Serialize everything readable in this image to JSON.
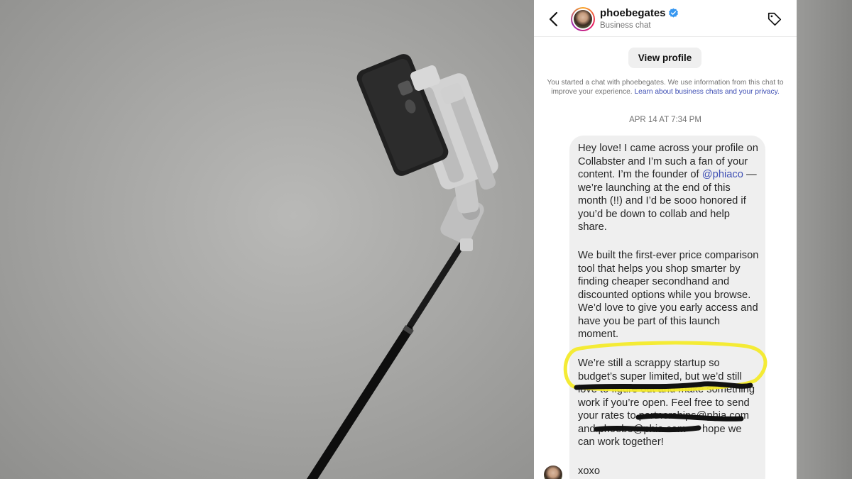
{
  "header": {
    "username": "phoebegates",
    "subtitle": "Business chat",
    "icons": [
      "chevron-left-icon",
      "verified-badge-icon",
      "tag-icon"
    ]
  },
  "view_profile_label": "View profile",
  "info": {
    "text": "You started a chat with phoebegates. We use information from this chat to improve your experience.",
    "link": "Learn about business chats and your privacy."
  },
  "timestamp": "APR 14 AT 7:34 PM",
  "message": {
    "p1_before": "Hey love! I came across your profile on Collabster and I’m such a fan of your content. I’m the founder of",
    "mention": "@phiaco",
    "p1_after": "— we’re launching at the end of this month (!!) and I’d be sooo honored if you’d be down to collab and help share.",
    "p2": "We built the first-ever price comparison tool that helps you shop smarter by finding cheaper secondhand and discounted options while you browse. We’d love to give you early access and have you be part of this launch moment.",
    "p3": "We’re still a scrappy startup so budget’s super limited, but we’d still love to figure out and make something work if you’re open. Feel free to send your rates to partnerships@phia.com and phoebe@phia.com — hope we can work together!",
    "p4": "xoxo"
  },
  "annotation_color": "#f3ea2a",
  "accent_color": "#3e4fb4",
  "verified_color": "#3797f0"
}
